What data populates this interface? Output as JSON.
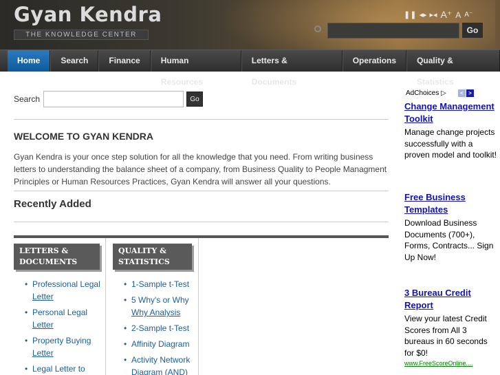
{
  "header": {
    "site_title": "Gyan Kendra",
    "tagline": "THE KNOWLEDGE CENTER",
    "controls": {
      "pause": "❚❚",
      "slower": "◂▸",
      "skip": "▸◂",
      "font_large": "A⁺",
      "font_normal": "A",
      "font_small": "A⁻"
    },
    "search_placeholder": "",
    "go_label": "Go"
  },
  "nav": {
    "items": [
      {
        "label": "Home",
        "active": true
      },
      {
        "label": "Search"
      },
      {
        "label": "Finance"
      },
      {
        "label": "Human Resources"
      },
      {
        "label": "Letters & Documents"
      },
      {
        "label": "Operations"
      },
      {
        "label": "Quality & Statistics"
      }
    ]
  },
  "main": {
    "search_label": "Search",
    "search_value": "",
    "search_go": "Go",
    "welcome_title": "WELCOME TO GYAN KENDRA",
    "welcome_text": "Gyan Kendra is your once step solution for all the knowledge that you need. From writing business letters to understanding the balance sheet of a company, from Business Quality to People Managment Principles or Human Resources Practices, Gyan Kendra will answer all your questions.",
    "recent_title": "Recently Added",
    "columns": [
      {
        "heading_line1": "LETTERS &",
        "heading_line2": "DOCUMENTS",
        "items": [
          {
            "a": "Professional Legal",
            "b": "Letter"
          },
          {
            "a": "Personal Legal",
            "b": "Letter"
          },
          {
            "a": "Property Buying",
            "b": "Letter"
          },
          {
            "a": "Legal Letter to",
            "b": ""
          }
        ]
      },
      {
        "heading_line1": "QUALITY &",
        "heading_line2": "STATISTICS",
        "items": [
          {
            "a": "1-Sample t-Test",
            "b": ""
          },
          {
            "a": "5 Why's or Why",
            "b": "Why Analysis"
          },
          {
            "a": "2-Sample t-Test",
            "b": ""
          },
          {
            "a": "Affinity Diagram",
            "b": ""
          },
          {
            "a": "Activity Network",
            "b": "Diagram (AND)"
          }
        ]
      }
    ]
  },
  "ads": {
    "adchoices": "AdChoices",
    "prev": "<",
    "next": ">",
    "items": [
      {
        "title": "Change Management Toolkit",
        "body": "Manage change projects successfully with a proven model and toolkit!"
      },
      {
        "title": "Free Business Templates",
        "body": "Download Business Documents (700+), Forms, Contracts... Sign Up Now!"
      },
      {
        "title": "3 Bureau Credit Report",
        "body": "View your latest Credit Scores from All 3 bureaus in 60 seconds for $0!",
        "url": "www.FreeScoreOnline...."
      }
    ]
  }
}
